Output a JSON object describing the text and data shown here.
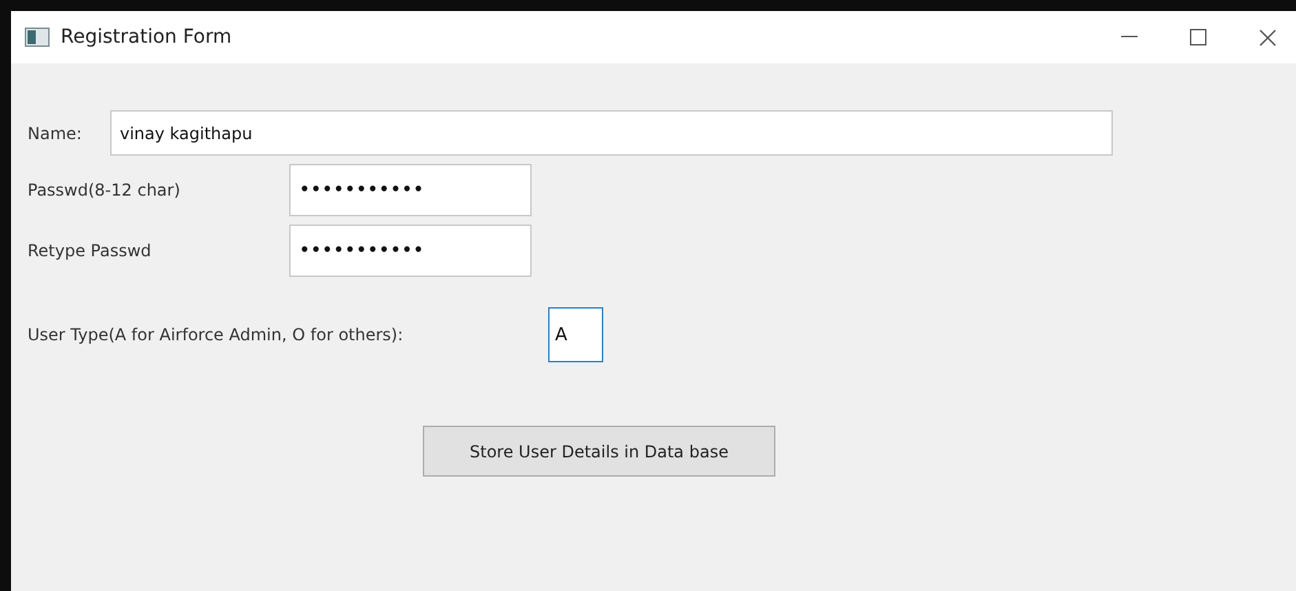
{
  "window": {
    "title": "Registration Form"
  },
  "fields": [
    {
      "label": "Name:",
      "value": "vinay kagithapu",
      "kind": "wide",
      "focused": false
    },
    {
      "label": "Passwd(8-12 char)",
      "value": "•••••••••••",
      "kind": "medium",
      "focused": false
    },
    {
      "label": "Retype Passwd",
      "value": "•••••••••••",
      "kind": "medium",
      "focused": false
    },
    {
      "label": "User Type(A for Airforce Admin, O for others):",
      "value": "A",
      "kind": "small",
      "focused": true
    }
  ],
  "button": {
    "label": "Store User Details in Data base"
  }
}
